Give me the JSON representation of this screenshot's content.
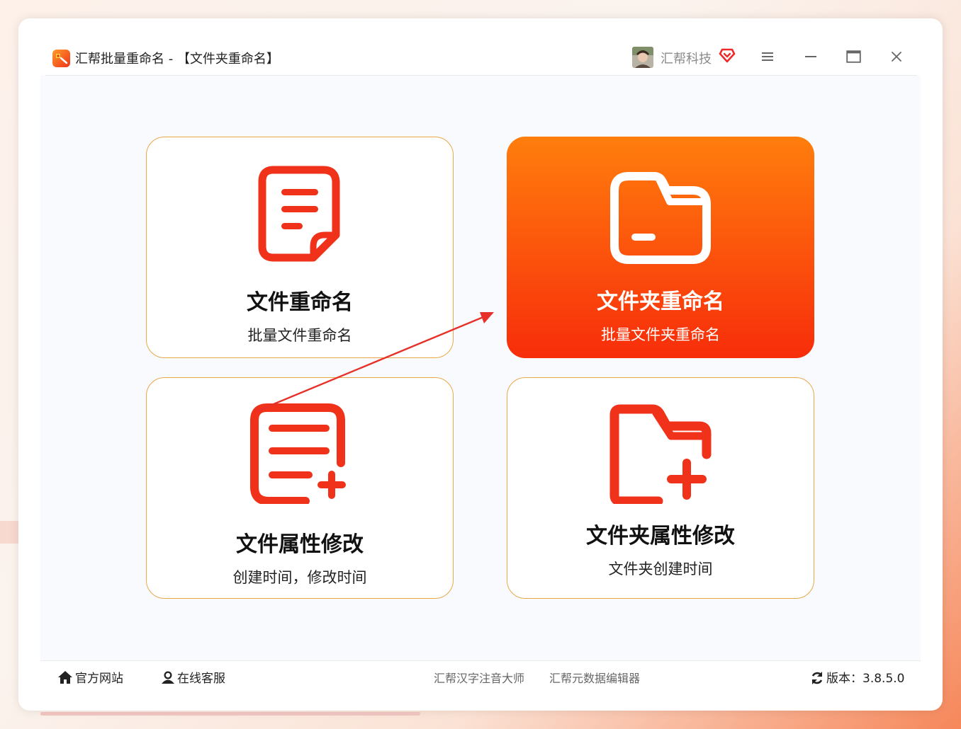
{
  "window": {
    "title": "汇帮批量重命名 - 【文件夹重命名】",
    "user_name": "汇帮科技",
    "icons": [
      "app-logo-icon",
      "user-avatar",
      "vip-heart-icon",
      "menu-icon",
      "minimize-icon",
      "maximize-icon",
      "close-icon"
    ]
  },
  "cards": [
    {
      "title": "文件重命名",
      "subtitle": "批量文件重命名",
      "icon": "document-icon",
      "active": false
    },
    {
      "title": "文件夹重命名",
      "subtitle": "批量文件夹重命名",
      "icon": "folder-icon",
      "active": true
    },
    {
      "title": "文件属性修改",
      "subtitle": "创建时间，修改时间",
      "icon": "document-add-icon",
      "active": false
    },
    {
      "title": "文件夹属性修改",
      "subtitle": "文件夹创建时间",
      "icon": "folder-add-icon",
      "active": false
    }
  ],
  "footer": {
    "website": "官方网站",
    "support": "在线客服",
    "links": [
      "汇帮汉字注音大师",
      "汇帮元数据编辑器"
    ],
    "version": "版本：3.8.5.0"
  },
  "colors": {
    "accent": "#fb4d0c",
    "icon_red": "#f0321a",
    "card_border": "#e8a84a",
    "arrow": "#e8302a"
  }
}
